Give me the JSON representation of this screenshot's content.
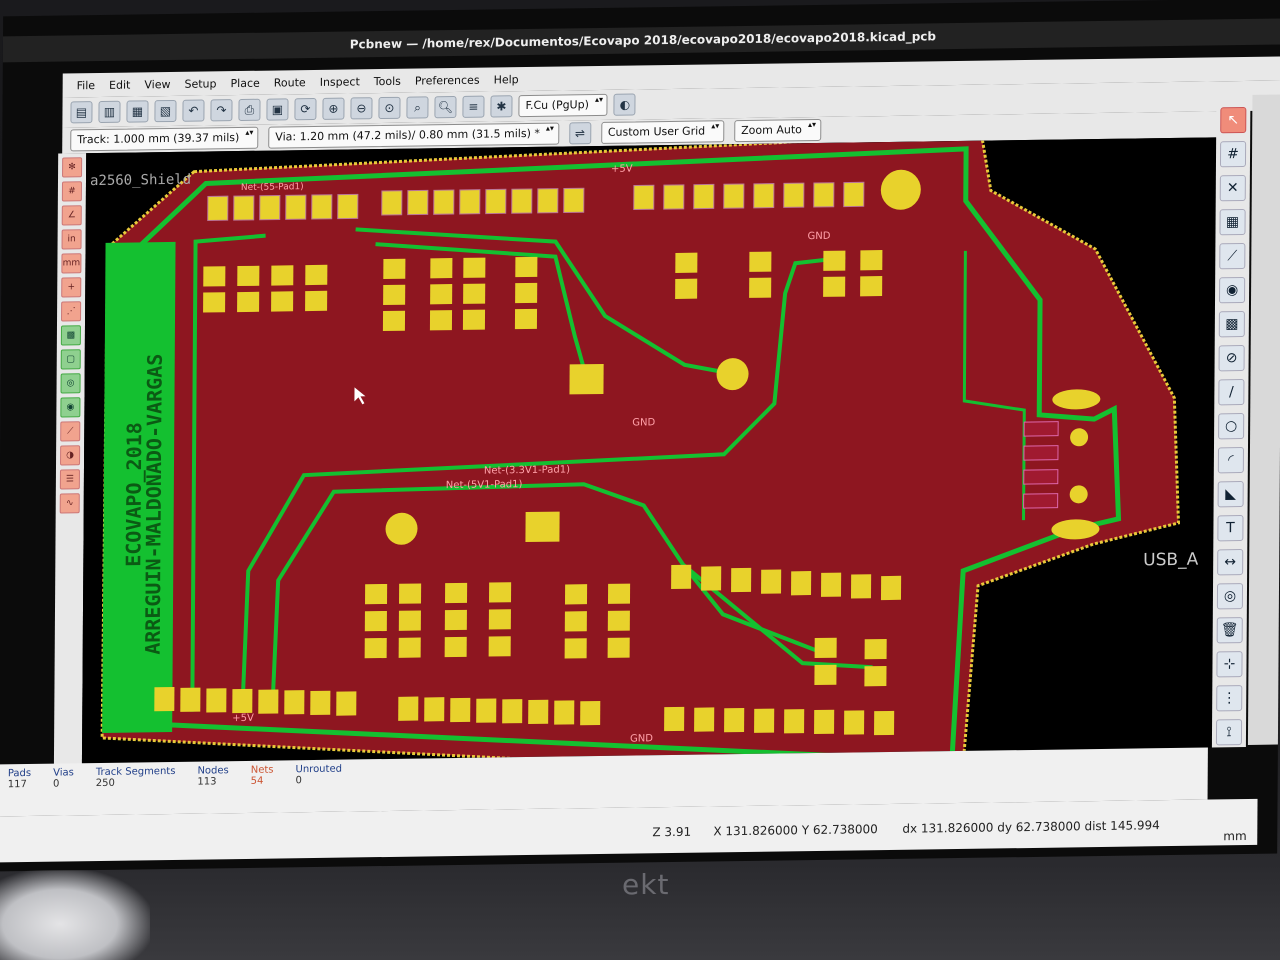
{
  "window": {
    "title": "Pcbnew — /home/rex/Documentos/Ecovapo 2018/ecovapo2018/ecovapo2018.kicad_pcb"
  },
  "menu": [
    "File",
    "Edit",
    "View",
    "Setup",
    "Place",
    "Route",
    "Inspect",
    "Tools",
    "Preferences",
    "Help"
  ],
  "toolbar": {
    "layer_select": "F.Cu (PgUp)",
    "track_width": "Track: 1.000 mm (39.37 mils)",
    "via_size": "Via: 1.20 mm (47.2 mils)/ 0.80 mm (31.5 mils) *",
    "grid": "Custom User Grid",
    "zoom": "Zoom Auto"
  },
  "board": {
    "sheet_title": "a2560_Shield",
    "silkscreen_line1": "ECOVAPO_2018",
    "silkscreen_line2": "ARREGUIN-MALDONADO-VARGAS",
    "connector_label": "USB_A",
    "net_labels": {
      "p5v": "+5V",
      "gnd": "GND",
      "net_55_pad1": "Net-(55-Pad1)",
      "net_3v3_pad1": "Net-(3.3V1-Pad1)",
      "net_5v1_pad1": "Net-(5V1-Pad1)"
    },
    "colors": {
      "copper_fill": "#8e1620",
      "track": "#14c030",
      "pad": "#e8d22c",
      "outline": "#e8c93a"
    }
  },
  "status": {
    "pads_label": "Pads",
    "pads": "117",
    "vias_label": "Vias",
    "vias": "0",
    "tracks_label": "Track Segments",
    "tracks": "250",
    "nodes_label": "Nodes",
    "nodes": "113",
    "nets_label": "Nets",
    "nets": "54",
    "unrouted_label": "Unrouted",
    "unrouted": "0"
  },
  "coords": {
    "zoom": "Z 3.91",
    "xy": "X 131.826000  Y 62.738000",
    "delta": "dx 131.826000  dy 62.738000  dist 145.994",
    "units": "mm"
  },
  "monitor_brand": "ekt"
}
